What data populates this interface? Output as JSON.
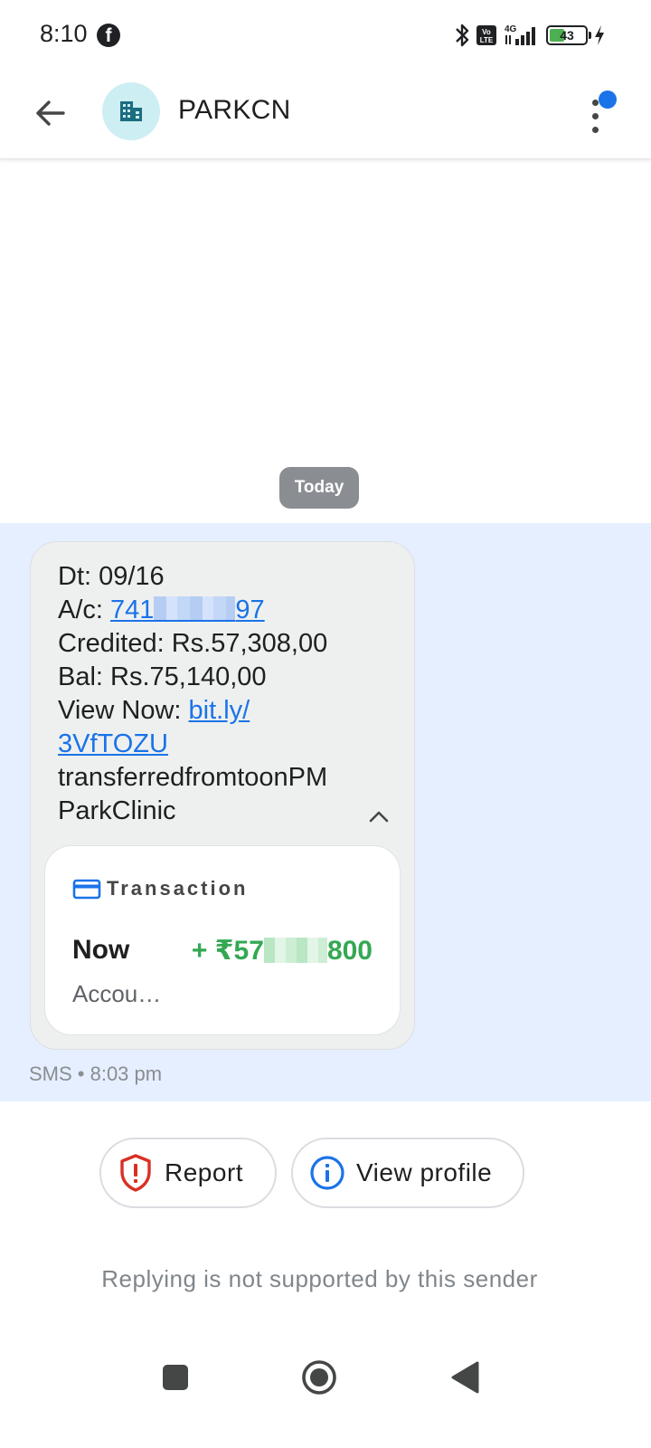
{
  "status_bar": {
    "time": "8:10",
    "battery_level": "43",
    "battery_percent": 43,
    "network": "4G",
    "volte": "Vo LTE",
    "icons": [
      "facebook-icon",
      "bluetooth-icon",
      "volte-icon",
      "signal-icon",
      "battery-icon",
      "charging-icon"
    ]
  },
  "header": {
    "contact_name": "PARKCN",
    "avatar_icon": "business-icon",
    "has_notification": true
  },
  "conversation": {
    "date_chip": "Today",
    "message": {
      "line_date": "Dt: 09/16",
      "account_prefix": "A/c: ",
      "account_start": "741",
      "account_end": "97",
      "line_credited": "Credited: Rs.57,308,00",
      "line_balance": "Bal: Rs.75,140,00",
      "view_prefix": "View Now: ",
      "link_part1": "bit.ly/",
      "link_part2": "3VfTOZU",
      "line_transfer": "transferredfromtoonPM",
      "line_sender": "ParkClinic"
    },
    "transaction_card": {
      "title": "Transaction",
      "when": "Now",
      "amount_start": "+ ₹57",
      "amount_end": "800",
      "description": "Accou…"
    },
    "meta": "SMS • 8:03 pm"
  },
  "actions": {
    "report_label": "Report",
    "view_profile_label": "View profile"
  },
  "reply_note": "Replying is not supported by this sender",
  "colors": {
    "accent": "#1a73e8",
    "highlight_band": "#e5efff",
    "credit_green": "#34a853",
    "report_red": "#d93025"
  }
}
